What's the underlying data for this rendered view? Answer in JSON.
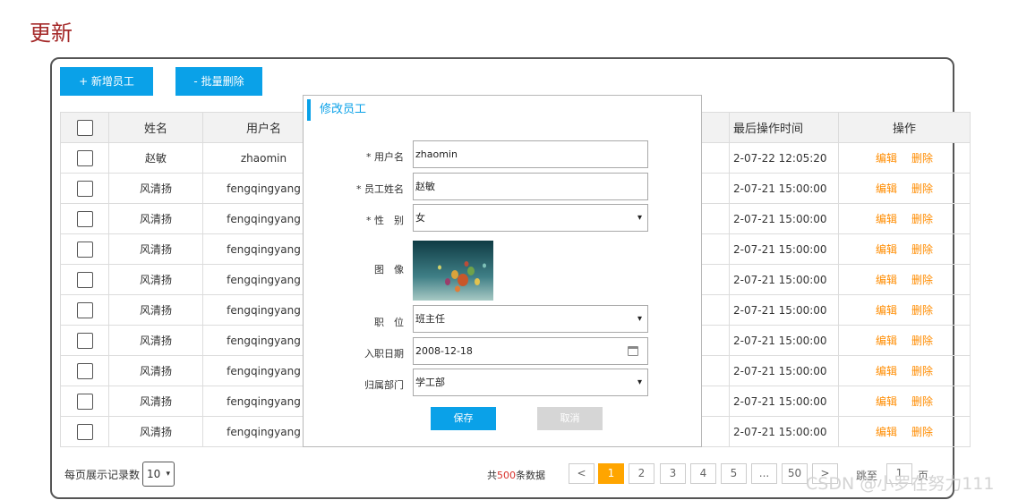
{
  "page": {
    "heading": "更新"
  },
  "toolbar": {
    "add_label": "+ 新增员工",
    "batch_delete_label": "- 批量删除"
  },
  "table": {
    "headers": {
      "name": "姓名",
      "username": "用户名",
      "last_op_time": "最后操作时间",
      "actions": "操作"
    },
    "rows": [
      {
        "name": "赵敏",
        "username": "zhaomin",
        "time": "2-07-22 12:05:20"
      },
      {
        "name": "风清扬",
        "username": "fengqingyang",
        "time": "2-07-21 15:00:00"
      },
      {
        "name": "风清扬",
        "username": "fengqingyang",
        "time": "2-07-21 15:00:00"
      },
      {
        "name": "风清扬",
        "username": "fengqingyang",
        "time": "2-07-21 15:00:00"
      },
      {
        "name": "风清扬",
        "username": "fengqingyang",
        "time": "2-07-21 15:00:00"
      },
      {
        "name": "风清扬",
        "username": "fengqingyang",
        "time": "2-07-21 15:00:00"
      },
      {
        "name": "风清扬",
        "username": "fengqingyang",
        "time": "2-07-21 15:00:00"
      },
      {
        "name": "风清扬",
        "username": "fengqingyang",
        "time": "2-07-21 15:00:00"
      },
      {
        "name": "风清扬",
        "username": "fengqingyang",
        "time": "2-07-21 15:00:00"
      },
      {
        "name": "风清扬",
        "username": "fengqingyang",
        "time": "2-07-21 15:00:00"
      }
    ],
    "edit_label": "编辑",
    "delete_label": "删除"
  },
  "modal": {
    "title": "修改员工",
    "fields": {
      "username": {
        "label": "* 用户名",
        "value": "zhaomin"
      },
      "name": {
        "label": "* 员工姓名",
        "value": "赵敏"
      },
      "gender": {
        "label": "* 性　别",
        "value": "女"
      },
      "image": {
        "label": "图　像"
      },
      "position": {
        "label": "职　位",
        "value": "班主任"
      },
      "entry_date": {
        "label": "入职日期",
        "value": "2008-12-18"
      },
      "department": {
        "label": "归属部门",
        "value": "学工部"
      }
    },
    "save_label": "保存",
    "cancel_label": "取消"
  },
  "footer": {
    "page_size_label": "每页展示记录数",
    "page_size_value": "10",
    "total_prefix": "共",
    "total_count": "500",
    "total_suffix": "条数据",
    "pages": [
      "<",
      "1",
      "2",
      "3",
      "4",
      "5",
      "...",
      "50",
      ">"
    ],
    "current_page": "1",
    "jump_label": "跳至",
    "jump_value": "1",
    "jump_suffix": "页"
  },
  "watermark": "CSDN @小罗在努力111",
  "colors": {
    "accent": "#0aa1e8",
    "link": "#ff8c00",
    "active_page": "#ffa500",
    "heading": "#a52a2a"
  }
}
